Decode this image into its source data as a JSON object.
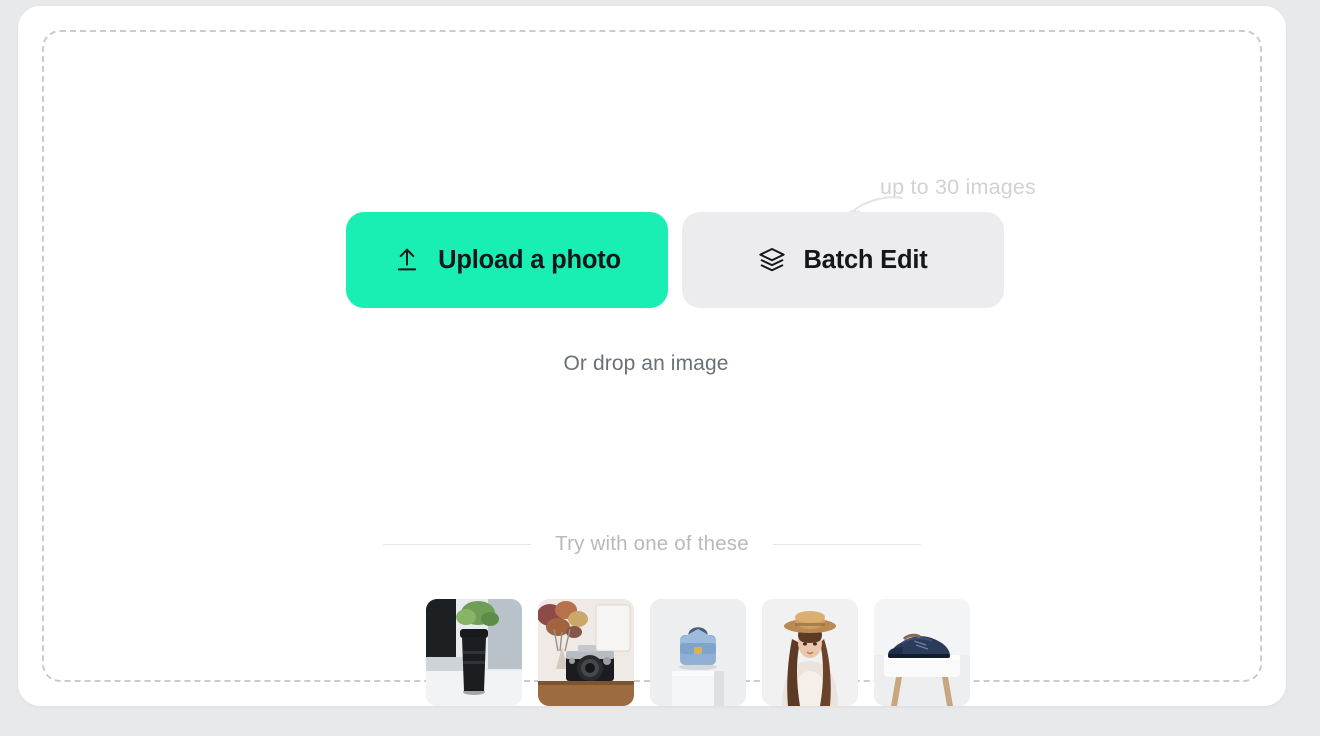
{
  "uploader": {
    "primary_action": {
      "label": "Upload a photo",
      "icon": "upload-arrow-icon",
      "color": "#19efb3"
    },
    "secondary_action": {
      "label": "Batch Edit",
      "icon": "layers-stack-icon",
      "color": "#ececee"
    },
    "drop_hint": "Or drop an image",
    "limit_note": "up to 30 images",
    "samples": {
      "title": "Try with one of these",
      "items": [
        {
          "name": "black-coffee-tumbler-on-desk"
        },
        {
          "name": "vintage-camera-with-dried-flowers"
        },
        {
          "name": "blue-handbag-on-pedestal"
        },
        {
          "name": "woman-in-straw-hat-and-lace-top"
        },
        {
          "name": "navy-dress-shoes-on-stool"
        }
      ]
    }
  }
}
